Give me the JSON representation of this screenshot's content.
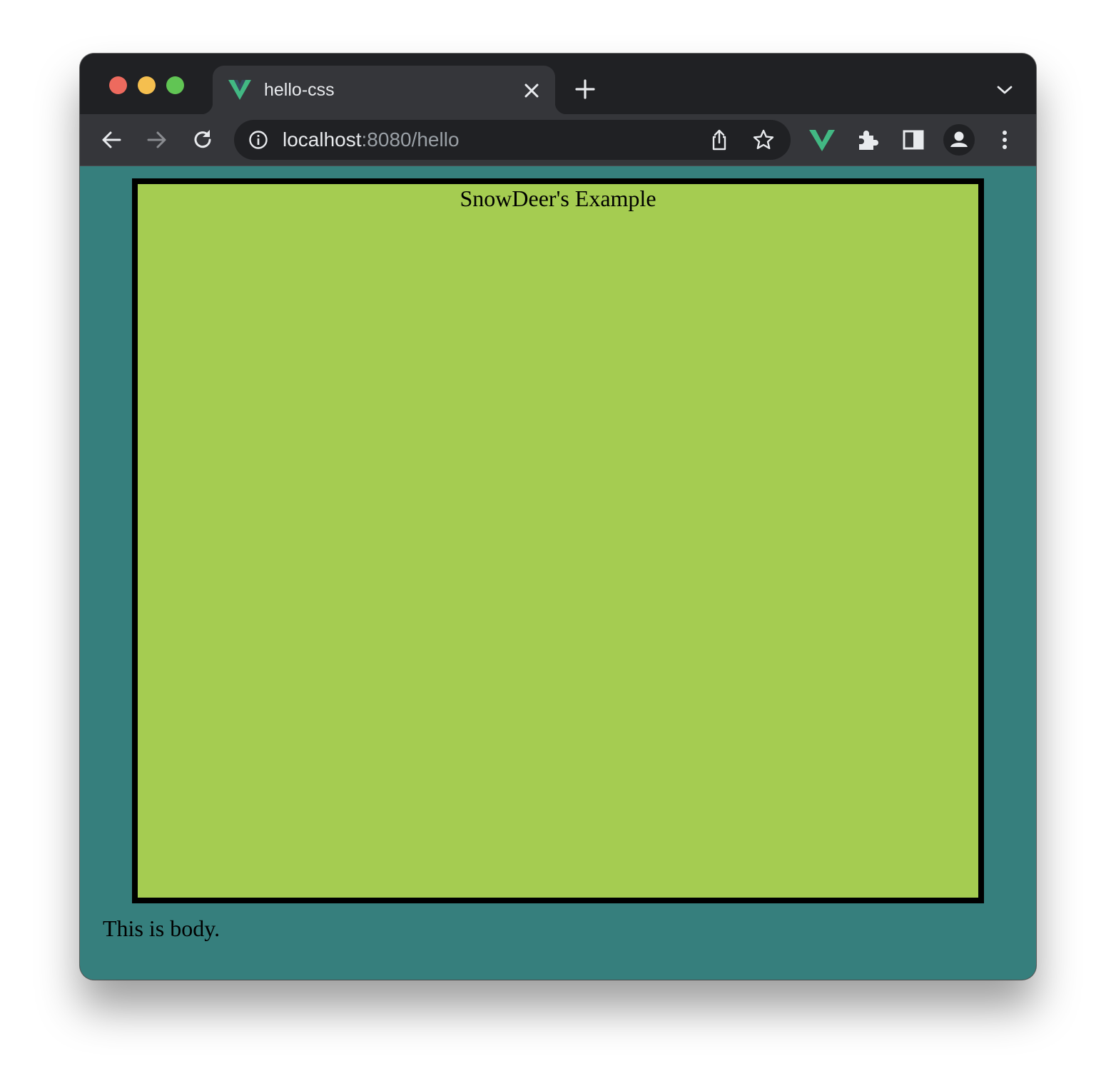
{
  "tab": {
    "title": "hello-css",
    "favicon": "vue-logo-icon"
  },
  "address_bar": {
    "host": "localhost",
    "port_path": ":8080/hello"
  },
  "page": {
    "box_title": "SnowDeer's Example",
    "body_text": "This is body."
  },
  "colors": {
    "page_background": "#367f7d",
    "box_background": "#a5cc51",
    "box_border": "#000000",
    "vue_green": "#42b883"
  },
  "icons": [
    "back-icon",
    "forward-icon",
    "reload-icon",
    "info-icon",
    "share-icon",
    "star-icon",
    "vue-devtools-icon",
    "extensions-icon",
    "side-panel-icon",
    "profile-icon",
    "menu-icon",
    "close-icon",
    "plus-icon",
    "chevron-down-icon"
  ]
}
